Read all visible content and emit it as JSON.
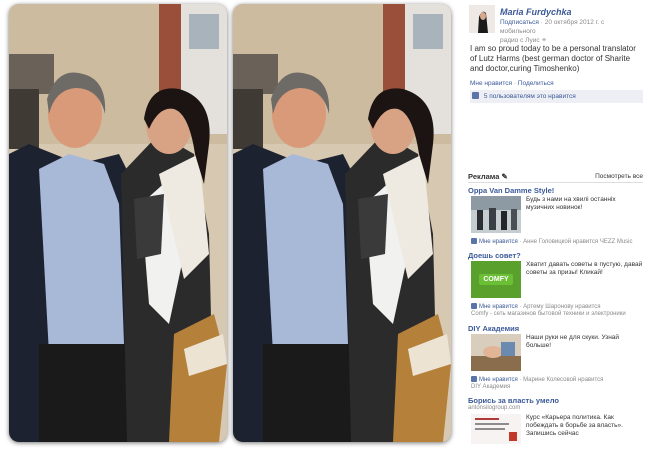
{
  "post": {
    "author": "Maria Furdychka",
    "subscribe": "Подписаться",
    "meta": "· 20 октября 2012 г. с мобильного",
    "meta2": "радио с Луис",
    "text": "I am so proud today to be a personal translator of Lutz Harms (best german doctor of Sharite and doctor,curing Timoshenko)",
    "like_link": "Мне нравится",
    "share_link": "Поделиться",
    "likes_count": "5 пользователям это нравится"
  },
  "ads": {
    "title": "Реклама",
    "more": "Посмотреть все",
    "items": [
      {
        "title": "Oppa Van Damme Style!",
        "text": "Будь з нами на хвилі останніх музичних новинок!",
        "like_label": "Мне нравится",
        "like_note": " · Анне Головицкой нравится ЧЕZZ Music",
        "sub": ""
      },
      {
        "title": "Доешь совет?",
        "text": "Хватит давать советы в пустую, давай советы за призы! Кликай!",
        "like_label": "Мне нравится",
        "like_note": " · Артему Шаронову нравится",
        "sub": "Comfy - сеть магазинов бытовой техники и электроники",
        "logo": "COMFY"
      },
      {
        "title": "DIY Академия",
        "text": "Наши руки не для скуки. Узнай больше!",
        "like_label": "Мне нравится",
        "like_note": " · Марине Колесовой нравится",
        "sub": "DIY Академия"
      },
      {
        "title": "Борись за власть умело",
        "domain": "antonsilogroup.com",
        "text": "Курс «Карьера политика. Как побеждать в борьбе за власть». Запишись сейчас"
      }
    ]
  },
  "colors": {
    "link": "#3b5998",
    "likes_bg": "#edeff4",
    "comfy": "#5aa02c"
  }
}
